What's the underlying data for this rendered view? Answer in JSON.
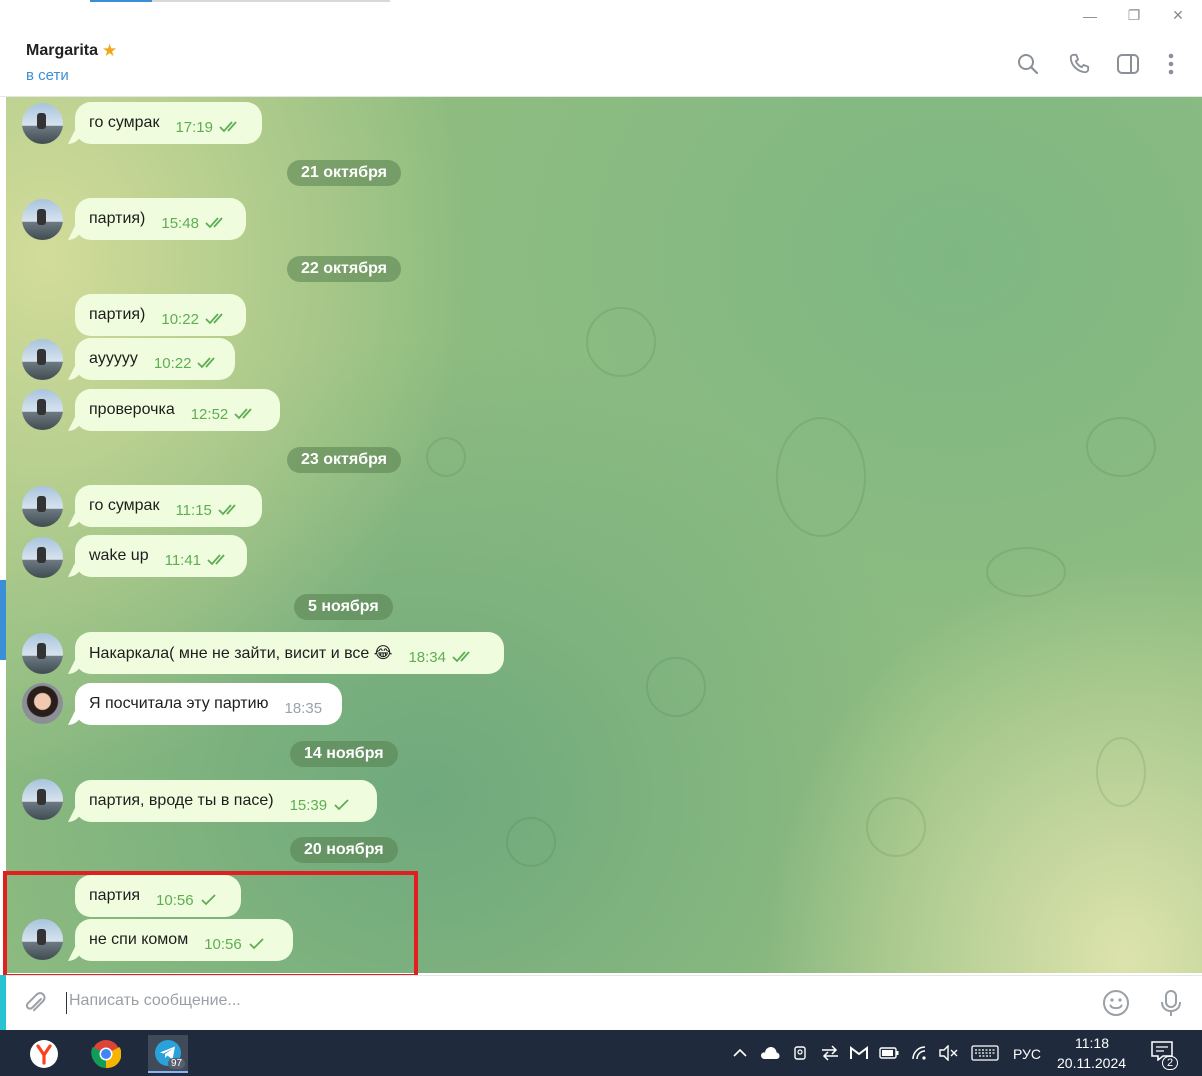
{
  "window": {
    "minimize_glyph": "—",
    "restore_glyph": "❐",
    "close_glyph": "✕"
  },
  "header": {
    "name": "Margarita",
    "name_emoji": "★",
    "status": "в сети",
    "icons": [
      "search-icon",
      "phone-icon",
      "sidebar-toggle-icon",
      "more-vertical-icon"
    ],
    "status_color": "#3a8fd6"
  },
  "messages": [
    {
      "text": "го сумрак",
      "time": "17:19",
      "checks": "double"
    },
    {
      "date": "21 октября"
    },
    {
      "text": "партия)",
      "time": "15:48",
      "checks": "double"
    },
    {
      "date": "22 октября"
    },
    {
      "text": "партия)",
      "time": "10:22",
      "checks": "double"
    },
    {
      "text": "ayyyyy",
      "time": "10:22",
      "checks": "double"
    },
    {
      "text": "проверочка",
      "time": "12:52",
      "checks": "double"
    },
    {
      "date": "23 октября"
    },
    {
      "text": "го сумрак",
      "time": "11:15",
      "checks": "double"
    },
    {
      "text": "wake up",
      "time": "11:41",
      "checks": "double"
    },
    {
      "date": "5 ноября"
    },
    {
      "text": "Накаркала( мне не зайти, висит и все 😂",
      "time": "18:34",
      "checks": "double"
    },
    {
      "text": "Я посчитала эту партию",
      "time": "18:35",
      "incoming": true
    },
    {
      "date": "14 ноября"
    },
    {
      "text": "партия, вроде ты в пасе)",
      "time": "15:39",
      "checks": "single"
    },
    {
      "date": "20 ноября"
    },
    {
      "text": "партия",
      "time": "10:56",
      "checks": "single"
    },
    {
      "text": "не спи комом",
      "time": "10:56",
      "checks": "single"
    }
  ],
  "composer": {
    "placeholder": "Написать сообщение..."
  },
  "taskbar": {
    "apps": [
      "yandex-browser-icon",
      "chrome-icon",
      "telegram-icon"
    ],
    "telegram_badge": "97",
    "language": "РУС",
    "time": "11:18",
    "date": "20.11.2024",
    "notifications": "2"
  },
  "colors": {
    "outgoing_bubble": "#effdde",
    "incoming_bubble": "#ffffff",
    "highlight": "#e02020",
    "taskbar": "#1f2b3d"
  }
}
